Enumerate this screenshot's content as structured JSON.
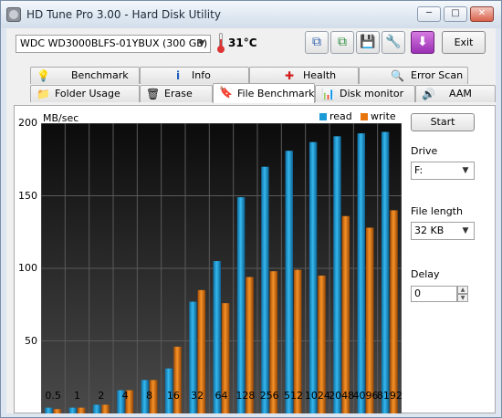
{
  "window": {
    "title": "HD Tune Pro 3.00 - Hard Disk Utility",
    "controls": {
      "minimize": "─",
      "maximize": "□",
      "close": "✕"
    }
  },
  "toolbar": {
    "drive": "WDC WD3000BLFS-01YBUX (300 GB)",
    "temperature": "31°C",
    "exit_label": "Exit"
  },
  "tabs_top": [
    {
      "label": "Benchmark",
      "icon": "lightbulb-icon",
      "glyph": "💡"
    },
    {
      "label": "Info",
      "icon": "info-icon",
      "glyph": "ℹ"
    },
    {
      "label": "Health",
      "icon": "health-cross-icon",
      "glyph": "✚"
    },
    {
      "label": "Error Scan",
      "icon": "magnifier-icon",
      "glyph": "🔍"
    }
  ],
  "tabs_bottom": [
    {
      "label": "Folder Usage",
      "icon": "folder-icon",
      "glyph": "📁"
    },
    {
      "label": "Erase",
      "icon": "trash-icon",
      "glyph": "🗑"
    },
    {
      "label": "File Benchmark",
      "icon": "file-benchmark-icon",
      "glyph": "🔖",
      "active": true
    },
    {
      "label": "Disk monitor",
      "icon": "disk-monitor-icon",
      "glyph": "📊"
    },
    {
      "label": "AAM",
      "icon": "speaker-icon",
      "glyph": "🔊"
    }
  ],
  "panel": {
    "start_label": "Start",
    "drive_label": "Drive",
    "drive_value": "F:",
    "file_length_label": "File length",
    "file_length_value": "32 KB",
    "delay_label": "Delay",
    "delay_value": "0"
  },
  "colors": {
    "read": "#1a9bd6",
    "write": "#e8740c"
  },
  "chart_data": {
    "type": "bar",
    "ylabel": "MB/sec",
    "ylim": [
      0,
      200
    ],
    "yticks": [
      50,
      100,
      150,
      200
    ],
    "categories": [
      "0.5",
      "1",
      "2",
      "4",
      "8",
      "16",
      "32",
      "64",
      "128",
      "256",
      "512",
      "1024",
      "2048",
      "4096",
      "8192"
    ],
    "series": [
      {
        "name": "read",
        "values": [
          4,
          4,
          6,
          16,
          23,
          31,
          77,
          105,
          149,
          170,
          181,
          187,
          191,
          193,
          194
        ]
      },
      {
        "name": "write",
        "values": [
          3,
          4,
          6,
          16,
          23,
          46,
          85,
          76,
          94,
          98,
          99,
          95,
          136,
          128,
          140
        ]
      }
    ],
    "legend": "top-right",
    "grid": true
  }
}
